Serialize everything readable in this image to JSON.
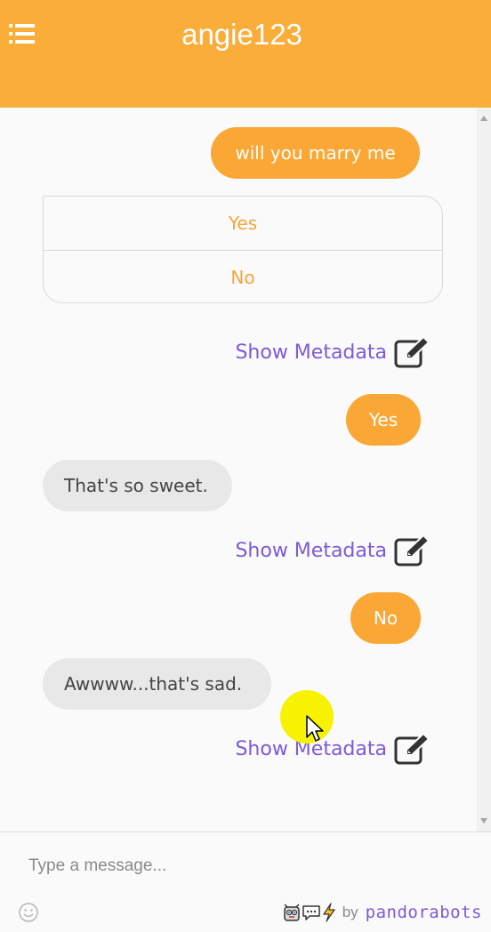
{
  "header": {
    "title": "angie123",
    "menu_icon": "hamburger-list-icon",
    "background_color": "#faad38"
  },
  "chat": {
    "messages": [
      {
        "from": "user",
        "text": "will you marry me"
      },
      {
        "from": "bot",
        "type": "buttons",
        "options": [
          "Yes",
          "No"
        ],
        "metadata_link": "Show Metadata"
      },
      {
        "from": "user",
        "text": "Yes"
      },
      {
        "from": "bot",
        "text": "That's so sweet.",
        "metadata_link": "Show Metadata"
      },
      {
        "from": "user",
        "text": "No"
      },
      {
        "from": "bot",
        "text": "Awwww...that's sad.",
        "metadata_link": "Show Metadata"
      }
    ],
    "edit_icon": "edit-pencil-icon",
    "user_bubble_color": "#faa735",
    "bot_bubble_color": "#e8e8e8",
    "link_color": "#7b5bd6"
  },
  "composer": {
    "placeholder": "Type a message...",
    "emoji_icon": "smiley-icon"
  },
  "branding": {
    "by": "by",
    "name": "pandorabots",
    "icons": [
      "robot-face-icon",
      "chat-bubble-icon",
      "lightning-icon"
    ]
  }
}
